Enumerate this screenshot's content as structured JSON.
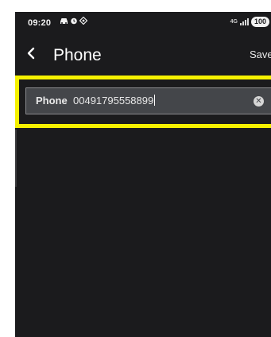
{
  "status_bar": {
    "time": "09:20",
    "left_icons": [
      "car-icon",
      "alarm-icon",
      "location-icon"
    ],
    "network": "4G",
    "battery": "100"
  },
  "header": {
    "back_glyph": "‹",
    "title": "Phone",
    "save_label": "Save"
  },
  "phone_field": {
    "label": "Phone",
    "value": "00491795558899",
    "clear_icon": "clear-icon"
  },
  "colors": {
    "background": "#1b1b1d",
    "field_background": "#44464a",
    "highlight": "#f5f100"
  }
}
